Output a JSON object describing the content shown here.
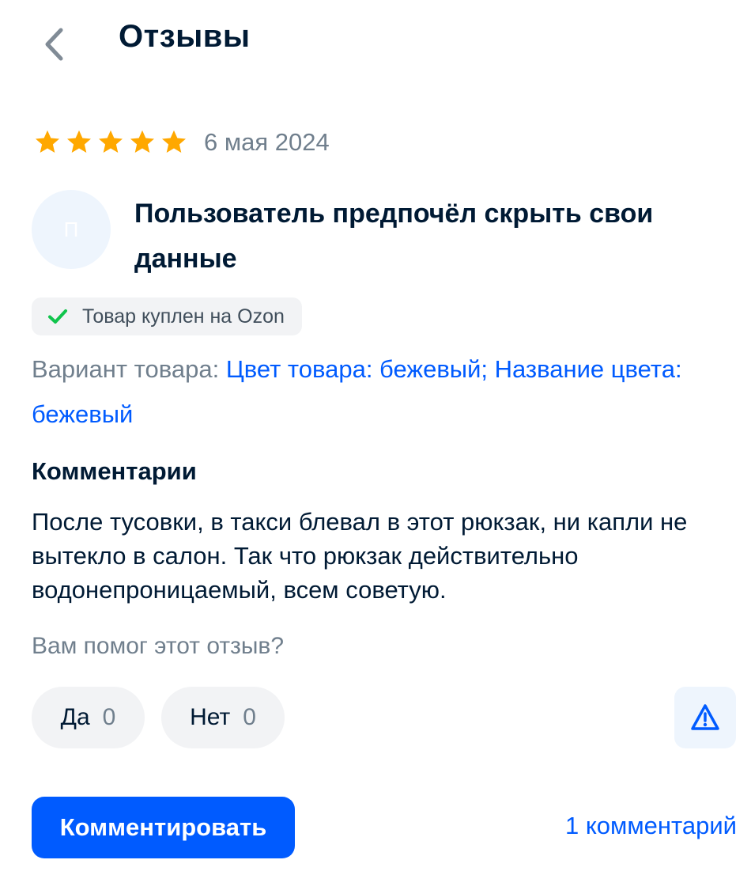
{
  "header": {
    "title": "Отзывы",
    "back_icon": "chevron-left-icon"
  },
  "review": {
    "rating": 5,
    "rating_max": 5,
    "star_color": "#ffa800",
    "date": "6 мая 2024",
    "author": {
      "avatar_letter": "П",
      "name": "Пользователь предпочёл скрыть свои данные"
    },
    "purchased_badge": {
      "icon": "check-icon",
      "text": "Товар куплен на Ozon"
    },
    "variant": {
      "label": "Вариант товара: ",
      "value": "Цвет товара: бежевый; Название цвета: бежевый"
    },
    "comments_heading": "Комментарии",
    "text": "После тусовки, в такси блевал в этот рюкзак, ни капли не вытекло в салон. Так что рюкзак действительно водонепроницаемый, всем советую."
  },
  "helpful": {
    "question": "Вам помог этот отзыв?",
    "yes": {
      "label": "Да",
      "count": "0"
    },
    "no": {
      "label": "Нет",
      "count": "0"
    },
    "report_icon": "warning-icon"
  },
  "actions": {
    "comment_button": "Комментировать",
    "comments_link": "1 комментарий"
  },
  "colors": {
    "accent": "#005bff",
    "text": "#001a34",
    "secondary_text": "#707f8d",
    "success": "#10c44c",
    "star": "#ffa800"
  }
}
